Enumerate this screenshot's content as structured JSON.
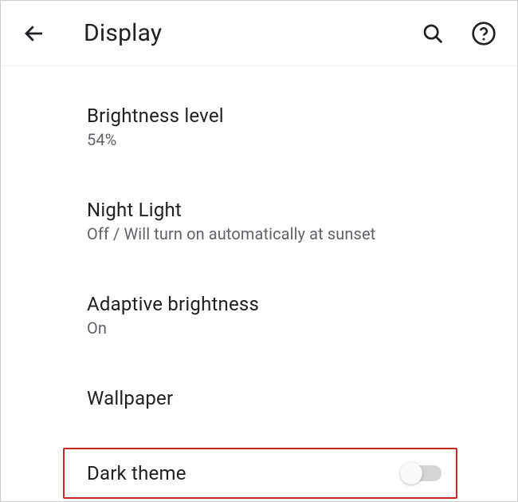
{
  "header": {
    "title": "Display"
  },
  "settings": {
    "brightness": {
      "title": "Brightness level",
      "value": "54%"
    },
    "nightLight": {
      "title": "Night Light",
      "value": "Off / Will turn on automatically at sunset"
    },
    "adaptive": {
      "title": "Adaptive brightness",
      "value": "On"
    },
    "wallpaper": {
      "title": "Wallpaper"
    },
    "darkTheme": {
      "title": "Dark theme",
      "enabled": false
    }
  }
}
